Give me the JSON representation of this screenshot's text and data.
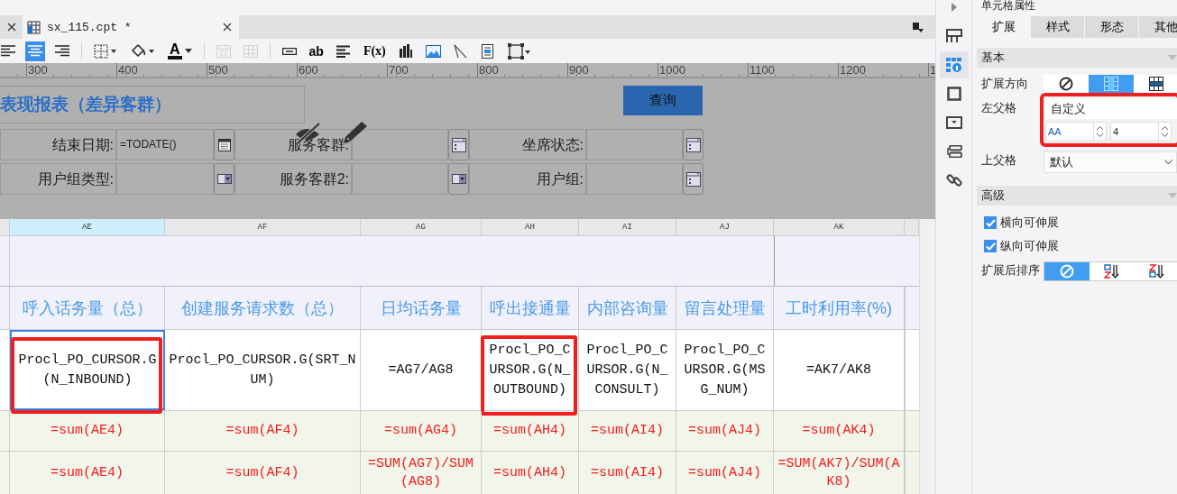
{
  "tabs": [
    {
      "label": "sx_115.cpt *",
      "selected": true
    }
  ],
  "toolbar": [
    {
      "kind": "align-left",
      "selected": false
    },
    {
      "kind": "align-center",
      "selected": true
    },
    {
      "kind": "align-right",
      "selected": false
    },
    {
      "kind": "border"
    },
    {
      "kind": "fill"
    },
    {
      "kind": "font-color",
      "label": "A"
    },
    {
      "kind": "merge",
      "disabled": true
    },
    {
      "kind": "unmerge",
      "disabled": true
    },
    {
      "kind": "text-field"
    },
    {
      "kind": "label",
      "label": "ab"
    },
    {
      "kind": "paragraph"
    },
    {
      "kind": "formula",
      "label": "F(x)"
    },
    {
      "kind": "chart"
    },
    {
      "kind": "image"
    },
    {
      "kind": "slash"
    },
    {
      "kind": "report"
    },
    {
      "kind": "frame"
    }
  ],
  "ruler": [
    "300",
    "400",
    "500",
    "600",
    "700",
    "800",
    "900",
    "1000",
    "1100",
    "1200",
    "1"
  ],
  "report": {
    "title": "表现报表（差异客群）",
    "query_button": "查询",
    "params": [
      {
        "label": "结束日期:",
        "value": "=TODATE()",
        "kind": "date"
      },
      {
        "label": "服务客群:",
        "kind": "list"
      },
      {
        "label": "坐席状态:",
        "kind": "list"
      },
      {
        "label": "用户组类型:",
        "kind": "combo"
      },
      {
        "label": "服务客群2:",
        "kind": "combo"
      },
      {
        "label": "用户组:",
        "kind": "list"
      }
    ]
  },
  "grid": {
    "columns": [
      {
        "label": "AE",
        "selected": true
      },
      {
        "label": "AF",
        "selected": false
      },
      {
        "label": "AG",
        "selected": false
      },
      {
        "label": "AH",
        "selected": false
      },
      {
        "label": "AI",
        "selected": false
      },
      {
        "label": "AJ",
        "selected": false
      },
      {
        "label": "AK",
        "selected": false
      }
    ],
    "headers": [
      "呼入话务量（总）",
      "创建服务请求数（总）",
      "日均话务量",
      "呼出接通量",
      "内部咨询量",
      "留言处理量",
      "工时利用率(%)"
    ],
    "formulas": [
      {
        "text": "Procl_PO_CURSOR.G(N_INBOUND)",
        "selected": true,
        "highlighted": true
      },
      {
        "text": "Procl_PO_CURSOR.G(SRT_NUM)",
        "selected": false,
        "highlighted": false
      },
      {
        "text": "=AG7/AG8",
        "selected": false,
        "highlighted": false
      },
      {
        "text": "Procl_PO_CURSOR.G(N_OUTBOUND)",
        "selected": false,
        "highlighted": true
      },
      {
        "text": "Procl_PO_CURSOR.G(N_CONSULT)",
        "selected": false,
        "highlighted": false
      },
      {
        "text": "Procl_PO_CURSOR.G(MSG_NUM)",
        "selected": false,
        "highlighted": false
      },
      {
        "text": "=AK7/AK8",
        "selected": false,
        "highlighted": false
      }
    ],
    "totals": [
      [
        "=sum(AE4)",
        "=sum(AF4)",
        "=sum(AG4)",
        "=sum(AH4)",
        "=sum(AI4)",
        "=sum(AJ4)",
        "=sum(AK4)"
      ],
      [
        "=sum(AE4)",
        "=sum(AF4)",
        "=SUM(AG7)/SUM(AG8)",
        "=sum(AH4)",
        "=sum(AI4)",
        "=sum(AJ4)",
        "=SUM(AK7)/SUM(AK8)"
      ]
    ]
  },
  "side_icons": [
    {
      "kind": "layout",
      "selected": false
    },
    {
      "kind": "cell-info",
      "selected": true
    },
    {
      "kind": "frame",
      "selected": false
    },
    {
      "kind": "widget",
      "selected": false
    },
    {
      "kind": "condition",
      "selected": false
    },
    {
      "kind": "link",
      "selected": false
    }
  ],
  "panel": {
    "title": "单元格属性",
    "tabs": [
      {
        "label": "扩展",
        "selected": true
      },
      {
        "label": "样式",
        "selected": false
      },
      {
        "label": "形态",
        "selected": false
      },
      {
        "label": "其他",
        "selected": false
      }
    ],
    "basic": {
      "title": "基本",
      "direction": {
        "label": "扩展方向",
        "options": [
          {
            "kind": "none",
            "selected": false
          },
          {
            "kind": "vertical",
            "selected": true
          },
          {
            "kind": "horizontal",
            "selected": false
          }
        ]
      },
      "left_parent": {
        "label": "左父格",
        "value": "自定义",
        "column": "AA",
        "row": "4",
        "highlighted": true
      },
      "top_parent": {
        "label": "上父格",
        "value": "默认"
      }
    },
    "advanced": {
      "title": "高级",
      "checks": [
        {
          "label": "横向可伸展",
          "checked": true
        },
        {
          "label": "纵向可伸展",
          "checked": true
        }
      ],
      "sort": {
        "label": "扩展后排序",
        "options": [
          {
            "kind": "none",
            "selected": true
          },
          {
            "kind": "asc",
            "selected": false
          },
          {
            "kind": "desc",
            "selected": false
          }
        ]
      }
    }
  }
}
